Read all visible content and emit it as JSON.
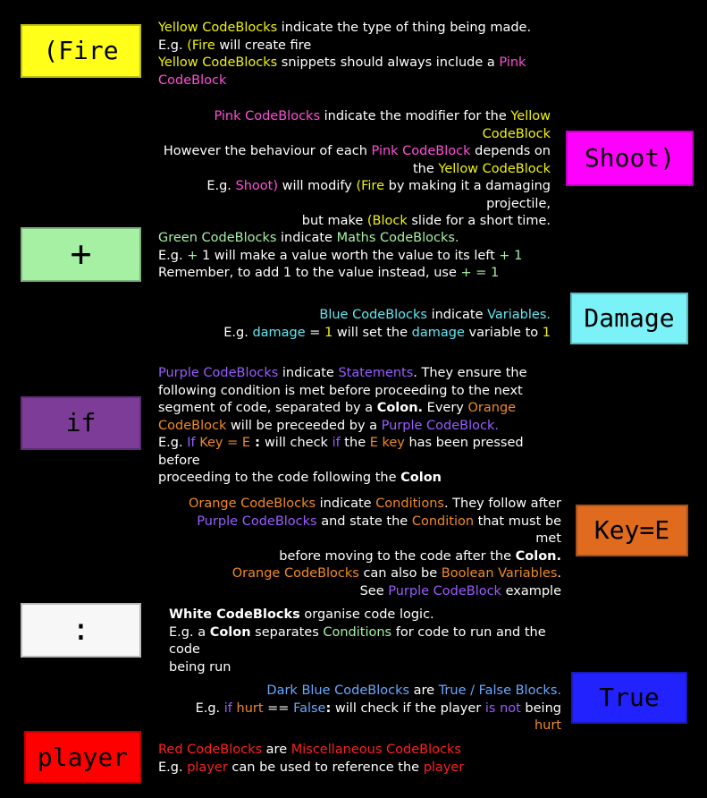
{
  "blocks": {
    "fire": {
      "label": "(Fire",
      "color": "#ffff1a"
    },
    "shoot": {
      "label": "Shoot)",
      "color": "#ff00ff"
    },
    "plus": {
      "label": "+",
      "color": "#a6f0a4"
    },
    "damage": {
      "label": "Damage",
      "color": "#7af2f7"
    },
    "if": {
      "label": "if",
      "color": "#7d3c98"
    },
    "key": {
      "label": "Key=E",
      "color": "#e06b1f"
    },
    "colon": {
      "label": ":",
      "color": "#f7f7f7"
    },
    "true": {
      "label": "True",
      "color": "#2222ff"
    },
    "player": {
      "label": "player",
      "color": "#ff0000"
    }
  },
  "yellow_text": {
    "a1": "Yellow CodeBlocks",
    "a2": " indicate the type of thing being made.",
    "b1": "E.g. ",
    "b2": "(Fire",
    "b3": " will create fire",
    "c1": "Yellow CodeBlocks",
    "c2": " snippets should always include a ",
    "c3": "Pink CodeBlock"
  },
  "pink_text": {
    "a1": "Pink CodeBlocks",
    "a2": " indicate the modifier for the ",
    "a3": "Yellow CodeBlock",
    "b1": "However the behaviour of each ",
    "b2": "Pink CodeBlock",
    "b3": " depends on the ",
    "b4": "Yellow CodeBlock",
    "c1": "E.g. ",
    "c2": "Shoot)",
    "c3": " will modify ",
    "c4": "(Fire",
    "c5": " by making it a damaging projectile,",
    "d1": "but make ",
    "d2": "(Block",
    "d3": " slide for a short time."
  },
  "green_text": {
    "a1": "Green CodeBlocks",
    "a2": " indicate ",
    "a3": "Maths CodeBlocks.",
    "b1": "E.g. ",
    "b2": "+",
    "b3": "  1 will make a value worth the value to its left ",
    "b4": "+ 1",
    "c1": "Remember, to add 1 to the value instead, use ",
    "c2": "+ = 1"
  },
  "blue_text": {
    "a1": "Blue CodeBlocks",
    "a2": " indicate  ",
    "a3": "Variables.",
    "b1": "E.g. ",
    "b2": "damage",
    "b3": " = ",
    "b4": "1",
    "b5": " will set the ",
    "b6": "damage",
    "b7": " variable to ",
    "b8": "1"
  },
  "purple_text": {
    "a1": "Purple CodeBlocks",
    "a2": " indicate ",
    "a3": "Statements",
    "a4": ". They ensure the",
    "b": "following condition is met before proceeding to the next",
    "c1": "segment of code, separated by a ",
    "c2": "Colon.",
    "c3": " Every ",
    "c4": "Orange",
    "d1": "CodeBlock",
    "d2": " will be preceeded by a ",
    "d3": "Purple CodeBlock.",
    "e1": "E.g. ",
    "e2": "If",
    "e3": " Key = E",
    "e4": " : ",
    "e5": "will check ",
    "e6": "if",
    "e7": " the ",
    "e8": "E key",
    "e9": " has been pressed before",
    "f1": "proceeding to the code following the ",
    "f2": "Colon"
  },
  "orange_text": {
    "a1": "Orange CodeBlocks",
    "a2": " indicate ",
    "a3": "Conditions",
    "a4": ". They follow after",
    "b1": "Purple CodeBlocks",
    "b2": " and state the ",
    "b3": "Condition",
    "b4": " that must be met",
    "c1": "before moving to the code after the ",
    "c2": "Colon.",
    "d1": "Orange CodeBlocks",
    "d2": " can also be ",
    "d3": "Boolean Variables",
    "e1": "See ",
    "e2": "Purple CodeBlock",
    "e3": " example"
  },
  "white_text": {
    "a1": "White CodeBlocks",
    "a2": " organise code logic.",
    "b1": "E.g. a ",
    "b2": "Colon",
    "b3": " separates ",
    "b4": "Conditions",
    "b5": " for code to run and the code",
    "c": "being run"
  },
  "darkblue_text": {
    "a1": "Dark Blue CodeBlocks",
    "a2": " are ",
    "a3": "True / False Blocks.",
    "b1": "E.g. ",
    "b2": "if",
    "b3": " ",
    "b4": "hurt",
    "b5": " == ",
    "b6": "False",
    "b7": ":",
    "b8": " will check if the player ",
    "b9": "is not",
    "b10": " being ",
    "b11": "hurt"
  },
  "red_text": {
    "a1": "Red CodeBlocks",
    "a2": " are ",
    "a3": "Miscellaneous CodeBlocks",
    "b1": "E.g. ",
    "b2": "player",
    "b3": " can be used to reference the  ",
    "b4": "player"
  }
}
